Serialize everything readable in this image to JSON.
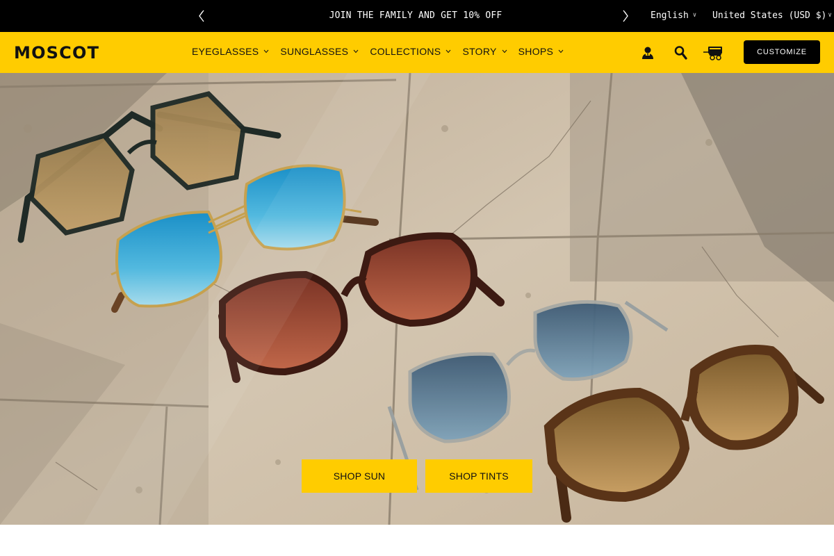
{
  "announcement": {
    "message": "JOIN THE FAMILY AND GET 10% OFF",
    "language": "English",
    "country": "United States (USD $)"
  },
  "nav": {
    "logo": "MOSCOT",
    "menu": [
      {
        "label": "EYEGLASSES"
      },
      {
        "label": "SUNGLASSES"
      },
      {
        "label": "COLLECTIONS"
      },
      {
        "label": "STORY"
      },
      {
        "label": "SHOPS"
      }
    ],
    "icons": [
      "account-icon",
      "search-icon",
      "cart-icon"
    ],
    "customize_label": "CUSTOMIZE"
  },
  "hero": {
    "buttons": {
      "shop_sun": "SHOP SUN",
      "shop_tints": "SHOP TINTS"
    }
  },
  "colors": {
    "brand_yellow": "#ffcc00",
    "topbar": "#000000",
    "text": "#111111"
  }
}
